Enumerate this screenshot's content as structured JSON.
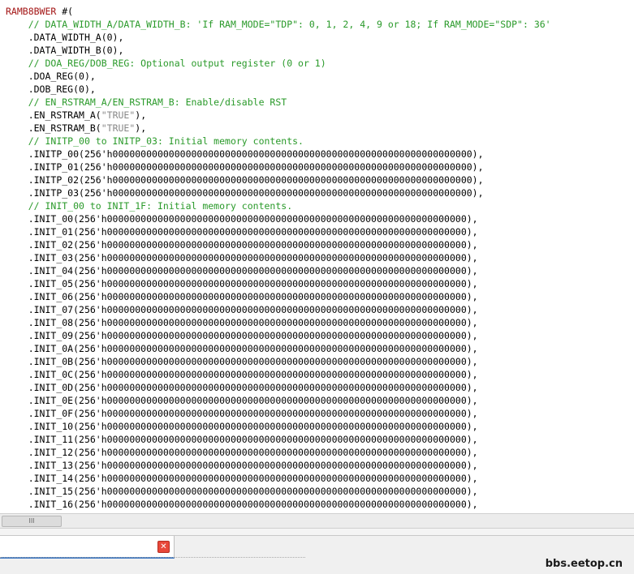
{
  "editor": {
    "lines": [
      {
        "indent": "",
        "segments": [
          {
            "t": "kw",
            "v": "RAMB8BWER"
          },
          {
            "t": "",
            "v": " #("
          }
        ]
      },
      {
        "indent": "    ",
        "segments": [
          {
            "t": "cm",
            "v": "// DATA_WIDTH_A/DATA_WIDTH_B: 'If RAM_MODE=\"TDP\": 0, 1, 2, 4, 9 or 18; If RAM_MODE=\"SDP\": 36'"
          }
        ]
      },
      {
        "indent": "    ",
        "segments": [
          {
            "t": "",
            "v": ".DATA_WIDTH_A(0),"
          }
        ]
      },
      {
        "indent": "    ",
        "segments": [
          {
            "t": "",
            "v": ".DATA_WIDTH_B(0),"
          }
        ]
      },
      {
        "indent": "    ",
        "segments": [
          {
            "t": "cm",
            "v": "// DOA_REG/DOB_REG: Optional output register (0 or 1)"
          }
        ]
      },
      {
        "indent": "    ",
        "segments": [
          {
            "t": "",
            "v": ".DOA_REG(0),"
          }
        ]
      },
      {
        "indent": "    ",
        "segments": [
          {
            "t": "",
            "v": ".DOB_REG(0),"
          }
        ]
      },
      {
        "indent": "    ",
        "segments": [
          {
            "t": "cm",
            "v": "// EN_RSTRAM_A/EN_RSTRAM_B: Enable/disable RST"
          }
        ]
      },
      {
        "indent": "    ",
        "segments": [
          {
            "t": "",
            "v": ".EN_RSTRAM_A("
          },
          {
            "t": "st",
            "v": "\"TRUE\""
          },
          {
            "t": "",
            "v": "),"
          }
        ]
      },
      {
        "indent": "    ",
        "segments": [
          {
            "t": "",
            "v": ".EN_RSTRAM_B("
          },
          {
            "t": "st",
            "v": "\"TRUE\""
          },
          {
            "t": "",
            "v": "),"
          }
        ]
      },
      {
        "indent": "    ",
        "segments": [
          {
            "t": "cm",
            "v": "// INITP_00 to INITP_03: Initial memory contents."
          }
        ]
      },
      {
        "indent": "    ",
        "segments": [
          {
            "t": "",
            "v": ".INITP_00(256'h0000000000000000000000000000000000000000000000000000000000000000),"
          }
        ]
      },
      {
        "indent": "    ",
        "segments": [
          {
            "t": "",
            "v": ".INITP_01(256'h0000000000000000000000000000000000000000000000000000000000000000),"
          }
        ]
      },
      {
        "indent": "    ",
        "segments": [
          {
            "t": "",
            "v": ".INITP_02(256'h0000000000000000000000000000000000000000000000000000000000000000),"
          }
        ]
      },
      {
        "indent": "    ",
        "segments": [
          {
            "t": "",
            "v": ".INITP_03(256'h0000000000000000000000000000000000000000000000000000000000000000),"
          }
        ]
      },
      {
        "indent": "    ",
        "segments": [
          {
            "t": "cm",
            "v": "// INIT_00 to INIT_1F: Initial memory contents."
          }
        ]
      },
      {
        "indent": "    ",
        "segments": [
          {
            "t": "",
            "v": ".INIT_00(256'h0000000000000000000000000000000000000000000000000000000000000000),"
          }
        ]
      },
      {
        "indent": "    ",
        "segments": [
          {
            "t": "",
            "v": ".INIT_01(256'h0000000000000000000000000000000000000000000000000000000000000000),"
          }
        ]
      },
      {
        "indent": "    ",
        "segments": [
          {
            "t": "",
            "v": ".INIT_02(256'h0000000000000000000000000000000000000000000000000000000000000000),"
          }
        ]
      },
      {
        "indent": "    ",
        "segments": [
          {
            "t": "",
            "v": ".INIT_03(256'h0000000000000000000000000000000000000000000000000000000000000000),"
          }
        ]
      },
      {
        "indent": "    ",
        "segments": [
          {
            "t": "",
            "v": ".INIT_04(256'h0000000000000000000000000000000000000000000000000000000000000000),"
          }
        ]
      },
      {
        "indent": "    ",
        "segments": [
          {
            "t": "",
            "v": ".INIT_05(256'h0000000000000000000000000000000000000000000000000000000000000000),"
          }
        ]
      },
      {
        "indent": "    ",
        "segments": [
          {
            "t": "",
            "v": ".INIT_06(256'h0000000000000000000000000000000000000000000000000000000000000000),"
          }
        ]
      },
      {
        "indent": "    ",
        "segments": [
          {
            "t": "",
            "v": ".INIT_07(256'h0000000000000000000000000000000000000000000000000000000000000000),"
          }
        ]
      },
      {
        "indent": "    ",
        "segments": [
          {
            "t": "",
            "v": ".INIT_08(256'h0000000000000000000000000000000000000000000000000000000000000000),"
          }
        ]
      },
      {
        "indent": "    ",
        "segments": [
          {
            "t": "",
            "v": ".INIT_09(256'h0000000000000000000000000000000000000000000000000000000000000000),"
          }
        ]
      },
      {
        "indent": "    ",
        "segments": [
          {
            "t": "",
            "v": ".INIT_0A(256'h0000000000000000000000000000000000000000000000000000000000000000),"
          }
        ]
      },
      {
        "indent": "    ",
        "segments": [
          {
            "t": "",
            "v": ".INIT_0B(256'h0000000000000000000000000000000000000000000000000000000000000000),"
          }
        ]
      },
      {
        "indent": "    ",
        "segments": [
          {
            "t": "",
            "v": ".INIT_0C(256'h0000000000000000000000000000000000000000000000000000000000000000),"
          }
        ]
      },
      {
        "indent": "    ",
        "segments": [
          {
            "t": "",
            "v": ".INIT_0D(256'h0000000000000000000000000000000000000000000000000000000000000000),"
          }
        ]
      },
      {
        "indent": "    ",
        "segments": [
          {
            "t": "",
            "v": ".INIT_0E(256'h0000000000000000000000000000000000000000000000000000000000000000),"
          }
        ]
      },
      {
        "indent": "    ",
        "segments": [
          {
            "t": "",
            "v": ".INIT_0F(256'h0000000000000000000000000000000000000000000000000000000000000000),"
          }
        ]
      },
      {
        "indent": "    ",
        "segments": [
          {
            "t": "",
            "v": ".INIT_10(256'h0000000000000000000000000000000000000000000000000000000000000000),"
          }
        ]
      },
      {
        "indent": "    ",
        "segments": [
          {
            "t": "",
            "v": ".INIT_11(256'h0000000000000000000000000000000000000000000000000000000000000000),"
          }
        ]
      },
      {
        "indent": "    ",
        "segments": [
          {
            "t": "",
            "v": ".INIT_12(256'h0000000000000000000000000000000000000000000000000000000000000000),"
          }
        ]
      },
      {
        "indent": "    ",
        "segments": [
          {
            "t": "",
            "v": ".INIT_13(256'h0000000000000000000000000000000000000000000000000000000000000000),"
          }
        ]
      },
      {
        "indent": "    ",
        "segments": [
          {
            "t": "",
            "v": ".INIT_14(256'h0000000000000000000000000000000000000000000000000000000000000000),"
          }
        ]
      },
      {
        "indent": "    ",
        "segments": [
          {
            "t": "",
            "v": ".INIT_15(256'h0000000000000000000000000000000000000000000000000000000000000000),"
          }
        ]
      },
      {
        "indent": "    ",
        "segments": [
          {
            "t": "",
            "v": ".INIT_16(256'h0000000000000000000000000000000000000000000000000000000000000000),"
          }
        ]
      }
    ]
  },
  "scrollbar": {
    "grip": "III"
  },
  "tab": {
    "close_glyph": "✕"
  },
  "watermark": {
    "text": "bbs.eetop.cn"
  },
  "colors": {
    "keyword": "#a31515",
    "comment": "#2a9a2a",
    "string": "#888888",
    "tab_accent": "#3a76c4",
    "close_bg": "#e8483a"
  }
}
